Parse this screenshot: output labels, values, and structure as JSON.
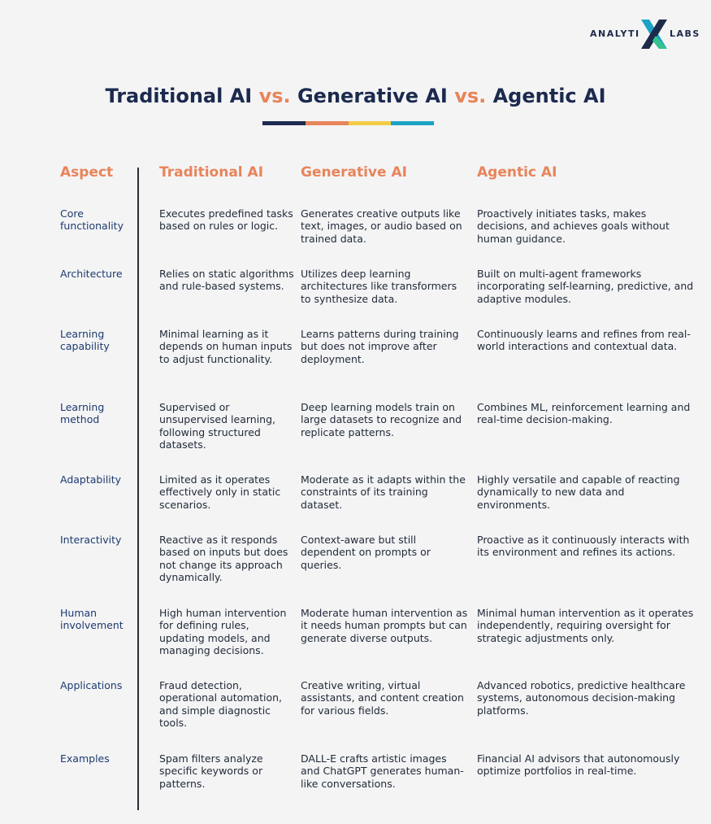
{
  "logo": {
    "left_text": "ANALYTI",
    "right_text": "LABS",
    "colors": {
      "navy": "#1e2a4a",
      "teal": "#1ba3c6",
      "green": "#34c38f"
    }
  },
  "title": {
    "part1": "Traditional AI",
    "vs1": "vs.",
    "part2": "Generative AI",
    "vs2": "vs.",
    "part3": "Agentic AI"
  },
  "underline_colors": [
    "#1c2a4e",
    "#e8845a",
    "#f2cd44",
    "#1ba3c6"
  ],
  "headers": {
    "aspect": "Aspect",
    "traditional": "Traditional AI",
    "generative": "Generative AI",
    "agentic": "Agentic AI"
  },
  "rows": [
    {
      "aspect": "Core functionality",
      "traditional": "Executes predefined tasks based on rules or logic.",
      "generative": "Generates creative outputs like text, images, or audio based on trained data.",
      "agentic": "Proactively initiates tasks, makes decisions, and achieves goals without human guidance."
    },
    {
      "aspect": "Architecture",
      "traditional": "Relies on static algorithms and rule-based systems.",
      "generative": "Utilizes deep learning architectures like transformers to synthesize data.",
      "agentic": "Built on multi-agent frameworks incorporating self-learning, predictive, and adaptive modules."
    },
    {
      "aspect": "Learning capability",
      "traditional": "Minimal learning as it depends on human inputs to adjust functionality.",
      "generative": "Learns patterns during training but does not improve after deployment.",
      "agentic": "Continuously learns and refines from real-world interactions and contextual data."
    },
    {
      "aspect": "Learning method",
      "traditional": "Supervised or unsupervised learning, following structured datasets.",
      "generative": "Deep learning models train on large datasets to recognize and replicate patterns.",
      "agentic": "Combines ML, reinforcement learning and real-time decision-making."
    },
    {
      "aspect": "Adaptability",
      "traditional": "Limited as it operates effectively only in static scenarios.",
      "generative": "Moderate as it adapts within the constraints of its training dataset.",
      "agentic": "Highly versatile and capable of reacting dynamically to new data and environments."
    },
    {
      "aspect": "Interactivity",
      "traditional": "Reactive as it responds based on inputs but does not change its approach dynamically.",
      "generative": "Context-aware but still dependent on prompts or queries.",
      "agentic": "Proactive as it continuously interacts with its environment and refines its actions."
    },
    {
      "aspect": "Human involvement",
      "traditional": "High human intervention for defining rules, updating models, and managing decisions.",
      "generative": "Moderate human intervention as it needs human prompts but can generate diverse outputs.",
      "agentic": "Minimal human intervention as it operates independently, requiring oversight for strategic adjustments only."
    },
    {
      "aspect": "Applications",
      "traditional": "Fraud detection, operational automation, and simple diagnostic tools.",
      "generative": "Creative writing, virtual assistants, and content creation for various fields.",
      "agentic": "Advanced robotics, predictive healthcare systems, autonomous decision-making platforms."
    },
    {
      "aspect": "Examples",
      "traditional": "Spam filters analyze specific keywords or patterns.",
      "generative": "DALL-E crafts artistic images and ChatGPT generates human-like conversations.",
      "agentic": "Financial AI advisors that autonomously optimize portfolios in real-time."
    }
  ]
}
